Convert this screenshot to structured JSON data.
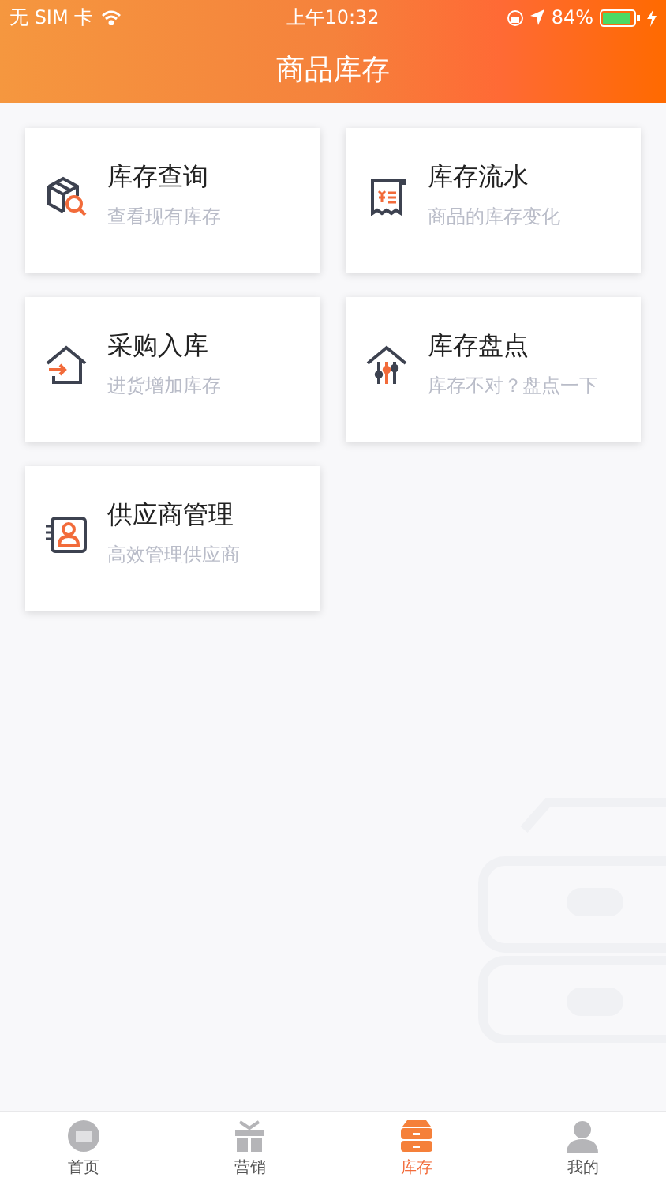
{
  "status_bar": {
    "carrier": "无 SIM 卡",
    "time": "上午10:32",
    "battery": "84%"
  },
  "nav_bar": {
    "title": "商品库存"
  },
  "cards": [
    {
      "title": "库存查询",
      "subtitle": "查看现有库存"
    },
    {
      "title": "库存流水",
      "subtitle": "商品的库存变化"
    },
    {
      "title": "采购入库",
      "subtitle": "进货增加库存"
    },
    {
      "title": "库存盘点",
      "subtitle": "库存不对？盘点一下"
    },
    {
      "title": "供应商管理",
      "subtitle": "高效管理供应商"
    }
  ],
  "tab_bar": [
    {
      "label": "首页",
      "selected": false
    },
    {
      "label": "营销",
      "selected": false
    },
    {
      "label": "库存",
      "selected": true
    },
    {
      "label": "我的",
      "selected": false
    }
  ]
}
